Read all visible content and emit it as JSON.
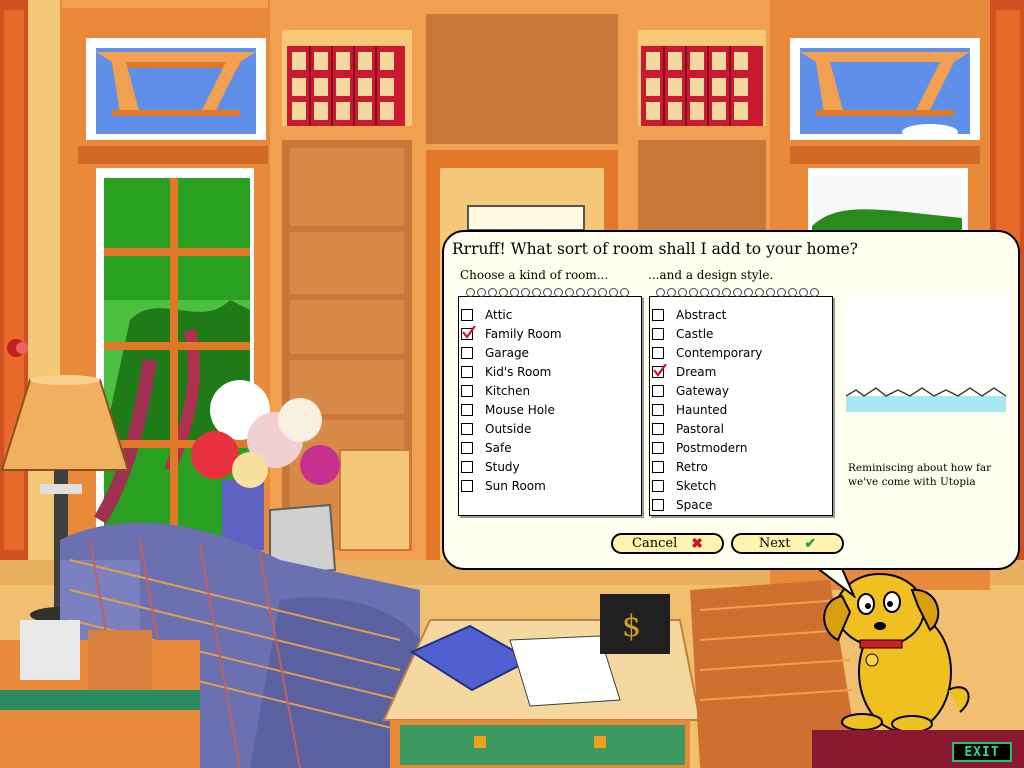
{
  "dialog": {
    "title": "Rrruff! What sort of room shall I add to your home?",
    "room_heading": "Choose a kind of room...",
    "style_heading": "...and a design style.",
    "rooms": [
      {
        "label": "Attic",
        "checked": false
      },
      {
        "label": "Family Room",
        "checked": true
      },
      {
        "label": "Garage",
        "checked": false
      },
      {
        "label": "Kid's Room",
        "checked": false
      },
      {
        "label": "Kitchen",
        "checked": false
      },
      {
        "label": "Mouse Hole",
        "checked": false
      },
      {
        "label": "Outside",
        "checked": false
      },
      {
        "label": "Safe",
        "checked": false
      },
      {
        "label": "Study",
        "checked": false
      },
      {
        "label": "Sun Room",
        "checked": false
      }
    ],
    "styles": [
      {
        "label": "Abstract",
        "checked": false
      },
      {
        "label": "Castle",
        "checked": false
      },
      {
        "label": "Contemporary",
        "checked": false
      },
      {
        "label": "Dream",
        "checked": true
      },
      {
        "label": "Gateway",
        "checked": false
      },
      {
        "label": "Haunted",
        "checked": false
      },
      {
        "label": "Pastoral",
        "checked": false
      },
      {
        "label": "Postmodern",
        "checked": false
      },
      {
        "label": "Retro",
        "checked": false
      },
      {
        "label": "Sketch",
        "checked": false
      },
      {
        "label": "Space",
        "checked": false
      }
    ],
    "preview_caption": "Reminiscing about how far we've come with Utopia",
    "cancel_label": "Cancel",
    "next_label": "Next"
  },
  "exit_label": "EXIT",
  "colors": {
    "dialog_bg": "#fffff0",
    "button_bg": "#fff3b0",
    "check_mark": "#d01030",
    "cancel_x": "#d01030",
    "next_check": "#20a050",
    "exit_text": "#1fdf8a",
    "wall": "#f0c070",
    "wood": "#e08838",
    "dog": "#f0c020"
  }
}
